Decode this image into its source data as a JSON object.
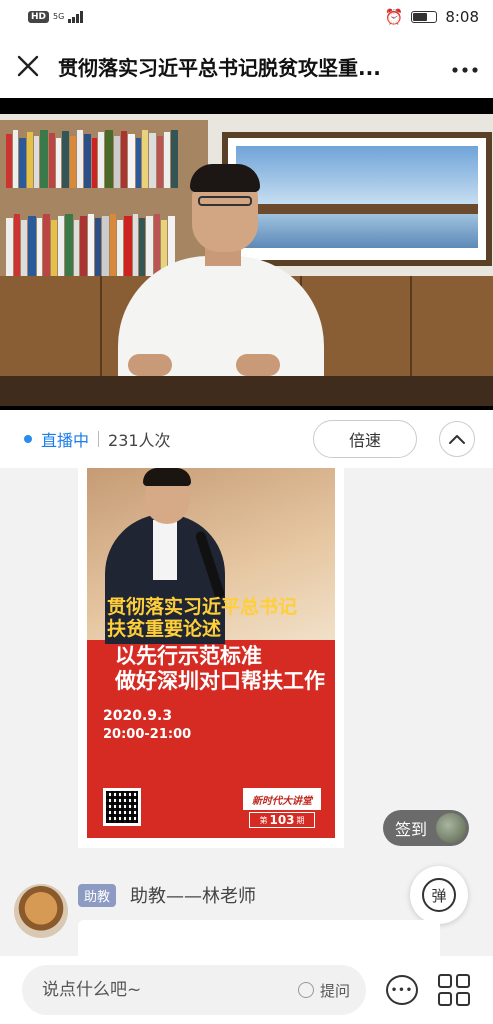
{
  "status_bar": {
    "hd": "HD",
    "network": "5G",
    "time": "8:08"
  },
  "header": {
    "title": "贯彻落实习近平总书记脱贫攻坚重..."
  },
  "live": {
    "status": "直播中",
    "viewers": "231人次",
    "speed_label": "倍速"
  },
  "poster": {
    "headline1": "贯彻落实习近平总书记",
    "headline1b": "扶贫重要论述",
    "headline2a": "以先行示范标准",
    "headline2b": "做好深圳对口帮扶工作",
    "date": "2020.9.3",
    "time": "20:00-21:00",
    "logo": "新时代大讲堂",
    "issue_prefix": "第",
    "issue_number": "103",
    "issue_suffix": "期"
  },
  "checkin": {
    "label": "签到"
  },
  "message": {
    "role_badge": "助教",
    "sender": "助教——林老师"
  },
  "danmu": {
    "label": "弹"
  },
  "bottom_bar": {
    "input_placeholder": "说点什么吧~",
    "ask_label": "提问"
  }
}
